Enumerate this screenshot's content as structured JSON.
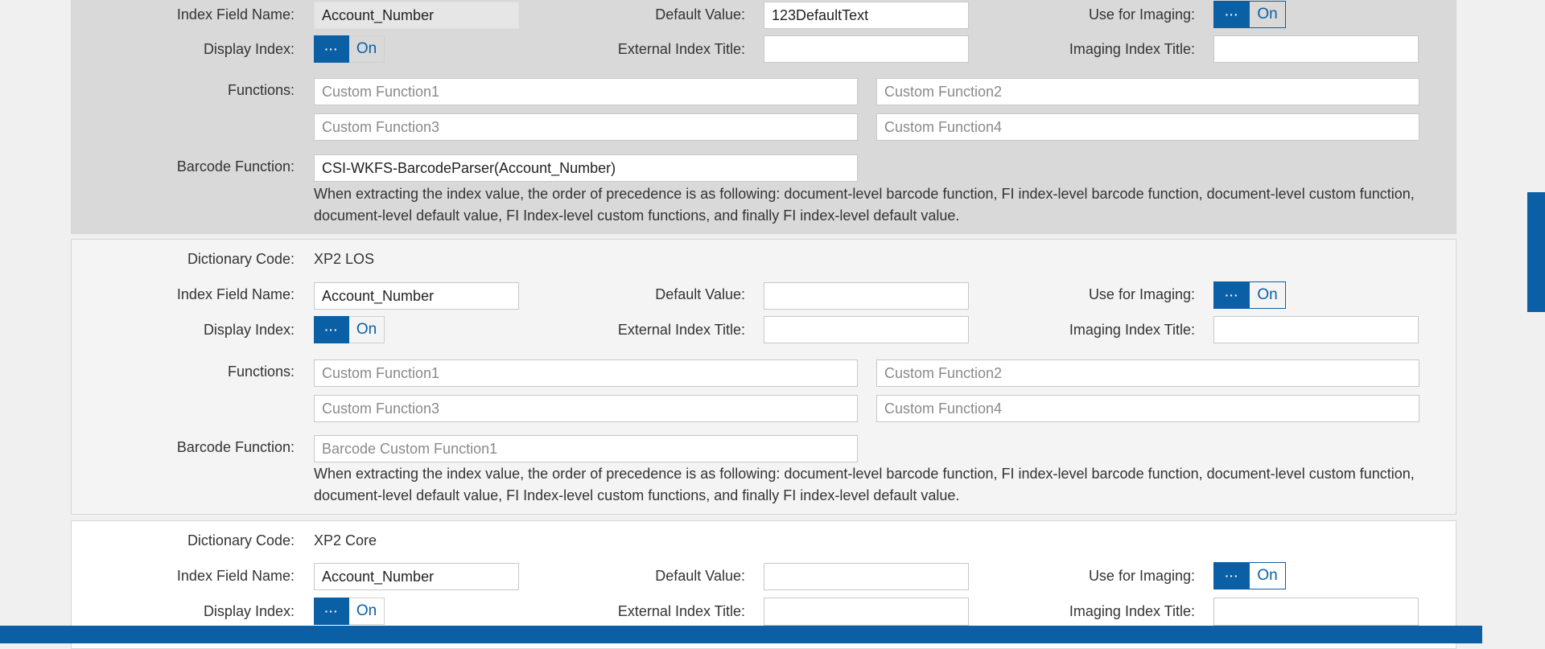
{
  "labels": {
    "dictionary_code": "Dictionary Code:",
    "index_field_name": "Index Field Name:",
    "default_value": "Default Value:",
    "use_for_imaging": "Use for Imaging:",
    "display_index": "Display Index:",
    "external_index_title": "External Index Title:",
    "imaging_index_title": "Imaging Index Title:",
    "functions": "Functions:",
    "barcode_function": "Barcode Function:"
  },
  "placeholders": {
    "custom_function1": "Custom Function1",
    "custom_function2": "Custom Function2",
    "custom_function3": "Custom Function3",
    "custom_function4": "Custom Function4",
    "barcode_custom_function1": "Barcode Custom Function1"
  },
  "toggle": {
    "knob_glyph": "···",
    "state": "On"
  },
  "precedence_note": "When extracting the index value, the order of precedence is as following: document-level barcode function, FI index-level barcode function, document-level custom function, document-level default value, FI Index-level custom functions, and finally FI index-level default value.",
  "sections": [
    {
      "dictionary_code": "",
      "index_field_name": "Account_Number",
      "default_value": "123DefaultText",
      "use_for_imaging": "On",
      "display_index": "On",
      "external_index_title": "",
      "imaging_index_title": "",
      "barcode_function": "CSI-WKFS-BarcodeParser(Account_Number)"
    },
    {
      "dictionary_code": "XP2 LOS",
      "index_field_name": "Account_Number",
      "default_value": "",
      "use_for_imaging": "On",
      "display_index": "On",
      "external_index_title": "",
      "imaging_index_title": "",
      "barcode_function": ""
    },
    {
      "dictionary_code": "XP2 Core",
      "index_field_name": "Account_Number",
      "default_value": "",
      "use_for_imaging": "On",
      "display_index": "On",
      "external_index_title": "",
      "imaging_index_title": ""
    }
  ],
  "colors": {
    "accent": "#0b5fa5",
    "panel_selected": "#d9d9d9",
    "page_bg": "#f0f0f0"
  }
}
